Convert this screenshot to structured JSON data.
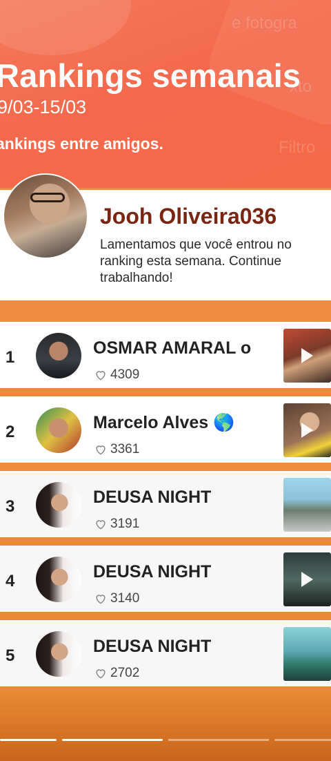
{
  "header": {
    "title": "Rankings semanais",
    "dates": "9/03-15/03",
    "subtitle": "ankings entre amigos.",
    "ghost_texts": [
      "e fotogra",
      "xto",
      "Filtro"
    ]
  },
  "user": {
    "name": "Jooh Oliveira036",
    "message": "Lamentamos que você entrou no ranking esta semana. Continue trabalhando!"
  },
  "rankings": [
    {
      "rank": "1",
      "name": "OSMAR AMARAL o",
      "likes": "4309"
    },
    {
      "rank": "2",
      "name": "Marcelo Alves 🌎",
      "likes": "3361"
    },
    {
      "rank": "3",
      "name": "DEUSA NIGHT",
      "likes": "3191"
    },
    {
      "rank": "4",
      "name": "DEUSA NIGHT",
      "likes": "3140"
    },
    {
      "rank": "5",
      "name": "DEUSA NIGHT",
      "likes": "2702"
    }
  ],
  "story_progress": {
    "segments": 4,
    "completed": 1,
    "current": 2,
    "current_fraction": 1.0
  },
  "colors": {
    "accent": "#f46b4a",
    "name": "#7a2512",
    "divider": "#ee8a36"
  },
  "icons": {
    "like": "heart-outline-icon",
    "play": "play-icon"
  }
}
